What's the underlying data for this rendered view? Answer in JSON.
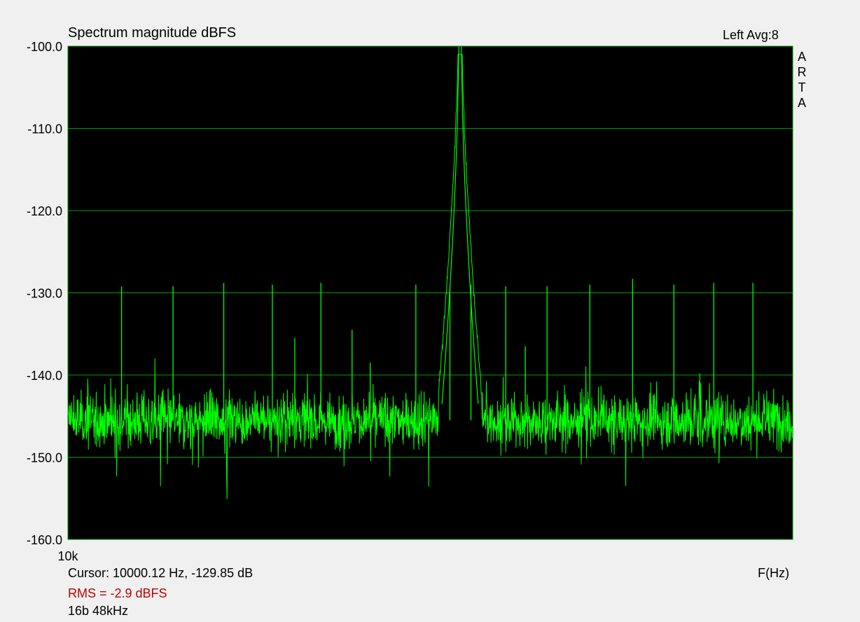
{
  "header": {
    "title": "Spectrum magnitude dBFS",
    "channel_avg": "Left  Avg:8",
    "brand_letters": [
      "A",
      "R",
      "T",
      "A"
    ]
  },
  "footer": {
    "cursor": "Cursor: 10000.12 Hz, -129.85 dB",
    "rms": "RMS =   -2.9 dBFS",
    "format": "16b 48kHz",
    "x_unit": "F(Hz)"
  },
  "colors": {
    "plot_background": "#000000",
    "grid": "#00a000",
    "trace": "#00ff00",
    "rms_text": "#c00000"
  },
  "chart_data": {
    "type": "line",
    "title": "Spectrum magnitude dBFS",
    "xlabel": "F(Hz)",
    "ylabel": "",
    "ylim": [
      -160,
      -100
    ],
    "y_ticks": [
      "-100.0",
      "-110.0",
      "-120.0",
      "-130.0",
      "-140.0",
      "-150.0",
      "-160.0"
    ],
    "x_ticks": [
      "10k"
    ],
    "grid": true,
    "noise_floor_db": -145.5,
    "noise_band_db": [
      -150,
      -141
    ],
    "carrier": {
      "x_pos": 0.541,
      "peak_db": -100
    },
    "spurs": [
      {
        "x_pos": 0.074,
        "db": -129.2
      },
      {
        "x_pos": 0.145,
        "db": -129.2
      },
      {
        "x_pos": 0.215,
        "db": -128.8
      },
      {
        "x_pos": 0.282,
        "db": -129.0
      },
      {
        "x_pos": 0.313,
        "db": -135.5
      },
      {
        "x_pos": 0.349,
        "db": -128.8
      },
      {
        "x_pos": 0.392,
        "db": -134.5
      },
      {
        "x_pos": 0.417,
        "db": -138.5
      },
      {
        "x_pos": 0.48,
        "db": -129.0
      },
      {
        "x_pos": 0.527,
        "db": -129.2
      },
      {
        "x_pos": 0.556,
        "db": -129.0
      },
      {
        "x_pos": 0.604,
        "db": -129.2
      },
      {
        "x_pos": 0.631,
        "db": -136.5
      },
      {
        "x_pos": 0.661,
        "db": -129.2
      },
      {
        "x_pos": 0.72,
        "db": -129.0
      },
      {
        "x_pos": 0.779,
        "db": -128.3
      },
      {
        "x_pos": 0.836,
        "db": -129.0
      },
      {
        "x_pos": 0.891,
        "db": -128.8
      },
      {
        "x_pos": 0.945,
        "db": -128.8
      }
    ]
  }
}
